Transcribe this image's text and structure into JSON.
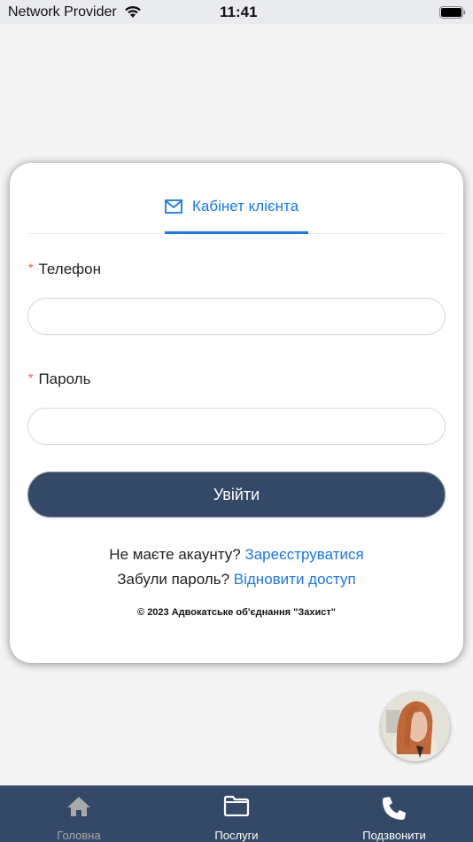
{
  "status_bar": {
    "carrier": "Network Provider",
    "time": "11:41",
    "icons": [
      "wifi-icon",
      "battery-icon"
    ]
  },
  "login_card": {
    "tab": {
      "icon": "mail-icon",
      "label": "Кабінет клієнта",
      "active": true
    },
    "fields": [
      {
        "label": "Телефон",
        "required_mark": "*",
        "value": "",
        "placeholder": ""
      },
      {
        "label": "Пароль",
        "required_mark": "*",
        "value": "",
        "placeholder": ""
      }
    ],
    "submit_label": "Увійти",
    "register_prompt": "Не маєте акаунту?",
    "register_link": "Зареєструватися",
    "forgot_prompt": "Забули пароль?",
    "forgot_link": "Відновити доступ",
    "copyright": "© 2023 Адвокатське об'єднання \"Захист\""
  },
  "chat_avatar": {
    "icon": "consultant-avatar"
  },
  "tab_bar": {
    "items": [
      {
        "icon": "home-icon",
        "label": "Головна",
        "active": false
      },
      {
        "icon": "folder-icon",
        "label": "Послуги",
        "active": true
      },
      {
        "icon": "phone-icon",
        "label": "Подзвонити",
        "active": true
      }
    ]
  },
  "colors": {
    "accent": "#1677ff",
    "primary_dark": "#344968",
    "required": "#ff4d4f",
    "background": "#f4f4f4"
  }
}
